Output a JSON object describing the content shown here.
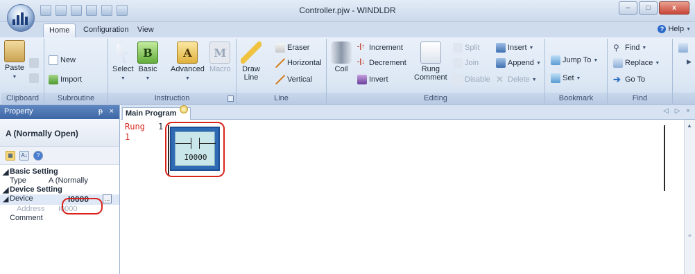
{
  "window": {
    "title": "Controller.pjw - WINDLDR",
    "controls": [
      "–",
      "□",
      "x"
    ]
  },
  "ribbon_tabs": [
    "Home",
    "Configuration",
    "View"
  ],
  "help_label": "Help",
  "groups": {
    "clipboard": {
      "label": "Clipboard",
      "paste": "Paste"
    },
    "subroutine": {
      "label": "Subroutine",
      "new": "New",
      "import": "Import"
    },
    "instruction": {
      "label": "Instruction",
      "select": "Select",
      "basic": "Basic",
      "advanced": "Advanced",
      "macro": "Macro"
    },
    "line": {
      "label": "Line",
      "draw_line": "Draw\nLine",
      "eraser": "Eraser",
      "horizontal": "Horizontal",
      "vertical": "Vertical"
    },
    "editing": {
      "label": "Editing",
      "coil": "Coil",
      "increment": "Increment",
      "decrement": "Decrement",
      "invert": "Invert",
      "rung_comment": "Rung\nComment",
      "split": "Split",
      "join": "Join",
      "disable": "Disable",
      "insert": "Insert",
      "append": "Append",
      "delete": "Delete"
    },
    "bookmark": {
      "label": "Bookmark",
      "jump_to": "Jump To",
      "set": "Set"
    },
    "find": {
      "label": "Find",
      "find": "Find",
      "replace": "Replace",
      "go_to": "Go To"
    }
  },
  "property_panel": {
    "header": "Property",
    "pin": "ᵽ",
    "close": "×",
    "title": "A (Normally Open)",
    "basic_setting": "Basic Setting",
    "type_key": "Type",
    "type_value": "A (Normally",
    "device_setting": "Device Setting",
    "device_key": "Device",
    "device_value": "I0000",
    "address_key": "Address",
    "address_value": "I0000",
    "comment_key": "Comment",
    "ellipsis": "..."
  },
  "document": {
    "tab_label": "Main Program",
    "nav": "◁ ▷ ×",
    "rung_label": "Rung",
    "rung_index": "1",
    "rung_number": "1",
    "contact_device": "I0000"
  },
  "colors": {
    "highlight": "#d9241c",
    "rung_text": "#d62a1e",
    "selection_border": "#2f6ab5"
  }
}
